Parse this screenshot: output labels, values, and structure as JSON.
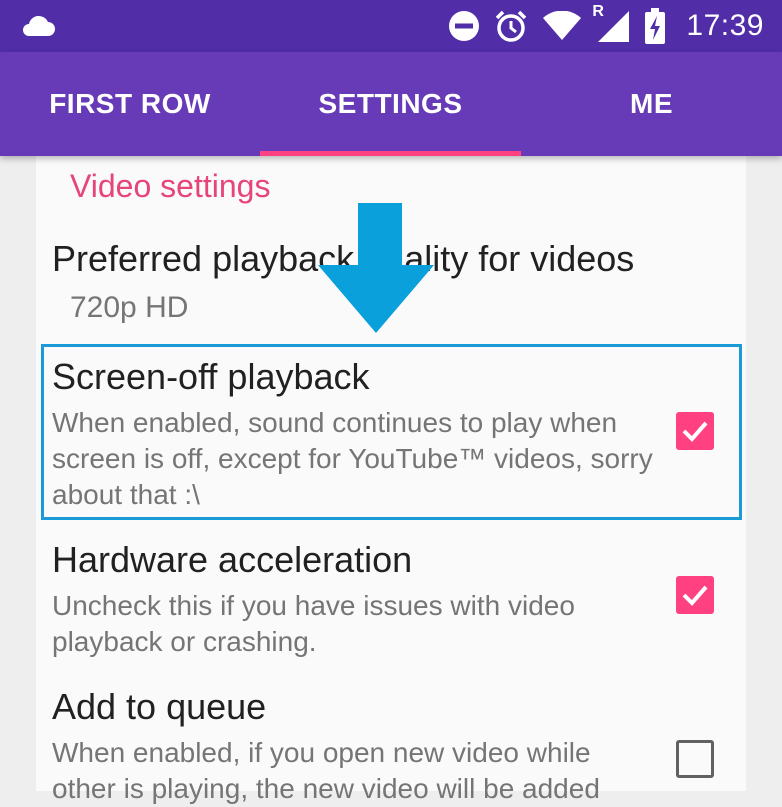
{
  "status_bar": {
    "time": "17:39",
    "network_label": "R",
    "icons": [
      "cloud-icon",
      "do-not-disturb-icon",
      "alarm-icon",
      "wifi-icon",
      "cellular-signal-icon",
      "battery-charging-icon"
    ]
  },
  "tabs": [
    {
      "label": "FIRST ROW",
      "selected": false
    },
    {
      "label": "SETTINGS",
      "selected": true
    },
    {
      "label": "ME",
      "selected": false
    }
  ],
  "colors": {
    "status_bar": "#512da8",
    "toolbar": "#673ab7",
    "accent": "#ff4081",
    "highlight": "#1a9bd7"
  },
  "settings": {
    "section_title": "Video settings",
    "quality": {
      "title": "Preferred playback quality for videos",
      "value": "720p HD"
    },
    "screen_off": {
      "title": "Screen-off playback",
      "description": "When enabled, sound continues to play when screen is off, except for YouTube™ videos, sorry about that :\\",
      "checked": true
    },
    "hardware": {
      "title": "Hardware acceleration",
      "description": "Uncheck this if you have issues with video playback or crashing.",
      "checked": true
    },
    "queue": {
      "title": "Add to queue",
      "description": "When enabled, if you open new video while other is playing, the new video will be added",
      "checked": false
    }
  }
}
